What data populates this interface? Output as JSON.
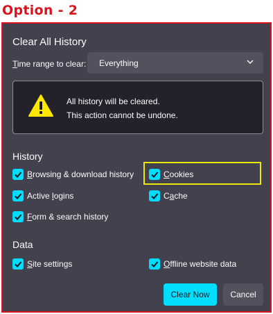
{
  "caption": "Option - 2",
  "dialog": {
    "title": "Clear All History",
    "time_range": {
      "label_u": "T",
      "label_rest": "ime range to clear:",
      "selected": "Everything"
    },
    "warning": {
      "line1": "All history will be cleared.",
      "line2": "This action cannot be undone."
    },
    "history": {
      "heading": "History",
      "items": [
        {
          "u": "B",
          "rest": "rowsing & download history",
          "checked": true
        },
        {
          "u": "C",
          "rest": "ookies",
          "checked": true
        },
        {
          "pre": "Active ",
          "u": "l",
          "rest": "ogins",
          "checked": true
        },
        {
          "pre": "C",
          "u": "a",
          "rest": "che",
          "checked": true
        },
        {
          "u": "F",
          "rest": "orm & search history",
          "checked": true
        }
      ]
    },
    "data": {
      "heading": "Data",
      "items": [
        {
          "u": "S",
          "rest": "ite settings",
          "checked": true
        },
        {
          "u": "O",
          "rest": "ffline website data",
          "checked": true
        }
      ]
    },
    "buttons": {
      "clear_now": "Clear Now",
      "cancel": "Cancel"
    }
  },
  "colors": {
    "accent": "#00ddff",
    "dialog_bg": "#42414d",
    "frame_red": "#d7151e",
    "highlight_yellow": "#e9ea0c"
  },
  "icons": {
    "warning": "warning-icon",
    "chevron": "chevron-down-icon",
    "check": "checkmark-icon"
  }
}
